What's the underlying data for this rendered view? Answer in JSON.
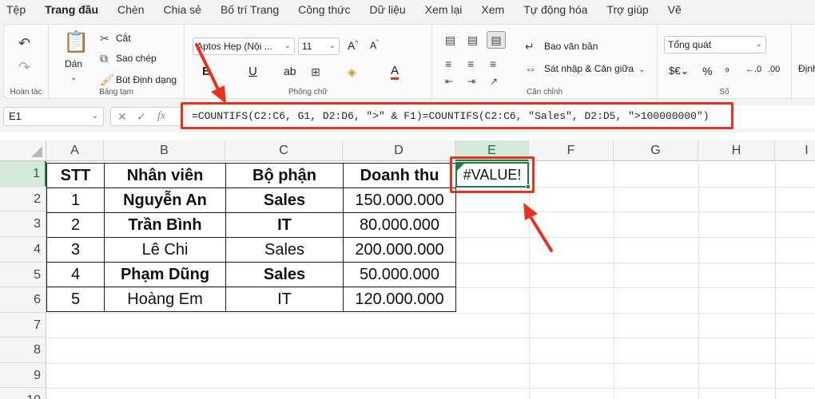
{
  "menu": {
    "items": [
      "Tệp",
      "Trang đầu",
      "Chèn",
      "Chia sẻ",
      "Bố trí Trang",
      "Công thức",
      "Dữ liệu",
      "Xem lại",
      "Xem",
      "Tự động hóa",
      "Trợ giúp",
      "Vẽ"
    ],
    "active": "Trang đầu"
  },
  "ribbon": {
    "undo_group_label": "Hoàn tác",
    "paste_label": "Dán",
    "cut_label": "Cắt",
    "copy_label": "Sao chép",
    "format_painter_label": "Bút Định dạng",
    "clipboard_label": "Bảng tạm",
    "font_name": "Aptos Hẹp (Nội ...",
    "font_size": "11",
    "font_group_label": "Phông chữ",
    "wrap_text_label": "Bao văn bản",
    "merge_center_label": "Sát nhập & Căn giữa",
    "alignment_label": "Căn chỉnh",
    "number_format": "Tổng quát",
    "number_label": "Số",
    "next_group_label": "Định"
  },
  "formula_bar": {
    "name_box": "E1",
    "formula": "=COUNTIFS(C2:C6, G1, D2:D6, \">\" & F1)=COUNTIFS(C2:C6, \"Sales\", D2:D5, \">100000000\")",
    "fx_label": "fx"
  },
  "grid": {
    "columns": [
      "A",
      "B",
      "C",
      "D",
      "E",
      "F",
      "G",
      "H",
      "I"
    ],
    "selected_column": "E",
    "rows": [
      "1",
      "2",
      "3",
      "4",
      "5",
      "6",
      "7",
      "8",
      "9",
      "10"
    ],
    "selected_row": "1",
    "table": {
      "headers": [
        "STT",
        "Nhân viên",
        "Bộ phận",
        "Doanh thu"
      ],
      "rows": [
        {
          "stt": "1",
          "name": "Nguyễn An",
          "dept": "Sales",
          "revenue": "150.000.000",
          "bold": true
        },
        {
          "stt": "2",
          "name": "Trần Bình",
          "dept": "IT",
          "revenue": "80.000.000",
          "bold": true
        },
        {
          "stt": "3",
          "name": "Lê Chi",
          "dept": "Sales",
          "revenue": "200.000.000",
          "bold": false
        },
        {
          "stt": "4",
          "name": "Phạm Dũng",
          "dept": "Sales",
          "revenue": "50.000.000",
          "bold": true
        },
        {
          "stt": "5",
          "name": "Hoàng Em",
          "dept": "IT",
          "revenue": "120.000.000",
          "bold": false
        }
      ]
    },
    "active_cell_value": "#VALUE!"
  },
  "colors": {
    "highlight": "#e8321f",
    "selection": "#1f7a46"
  }
}
